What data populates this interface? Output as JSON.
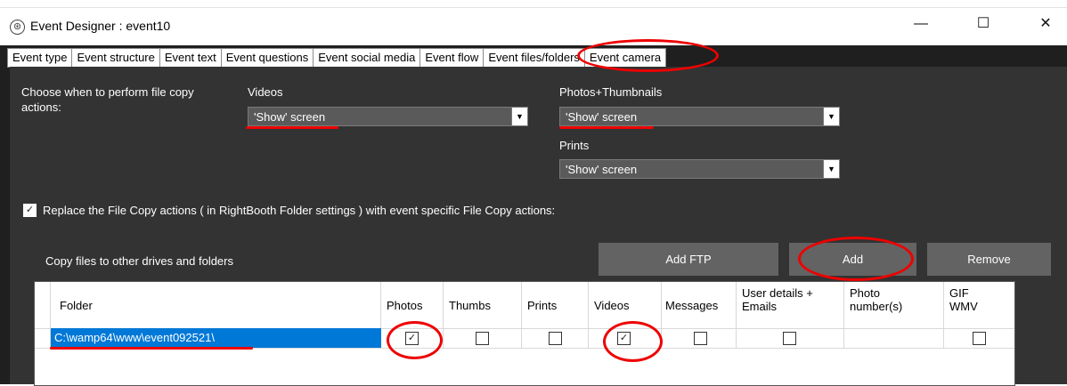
{
  "window": {
    "title": "Event Designer : event10",
    "minimize": "—",
    "maximize": "☐",
    "close": "✕"
  },
  "tabs": [
    {
      "label": "Event type"
    },
    {
      "label": "Event structure"
    },
    {
      "label": "Event text"
    },
    {
      "label": "Event questions"
    },
    {
      "label": "Event social media"
    },
    {
      "label": "Event flow"
    },
    {
      "label": "Event files/folders",
      "active": true
    },
    {
      "label": "Event camera"
    }
  ],
  "copy_actions": {
    "label": "Choose when to perform file copy actions:",
    "videos": {
      "label": "Videos",
      "value": "'Show' screen"
    },
    "photos": {
      "label": "Photos+Thumbnails",
      "value": "'Show' screen"
    },
    "prints": {
      "label": "Prints",
      "value": "'Show' screen"
    }
  },
  "replace": {
    "checked": true,
    "label": "Replace the File Copy actions ( in RightBooth Folder settings ) with event specific File Copy actions:"
  },
  "copy_files": {
    "label": "Copy files to other drives and folders",
    "add_ftp": "Add FTP",
    "add": "Add",
    "remove": "Remove"
  },
  "grid": {
    "columns": [
      "Folder",
      "Photos",
      "Thumbs",
      "Prints",
      "Videos",
      "Messages",
      "User details + Emails",
      "Photo number(s)",
      "GIF WMV"
    ],
    "rows": [
      {
        "folder": "C:\\wamp64\\www\\event092521\\",
        "photos": true,
        "thumbs": false,
        "prints": false,
        "videos": true,
        "messages": false,
        "user_details": false,
        "photo_numbers": "",
        "gif": false
      }
    ]
  },
  "colors": {
    "annotation": "#e00000",
    "selection": "#0078d7",
    "panel": "#333333"
  }
}
